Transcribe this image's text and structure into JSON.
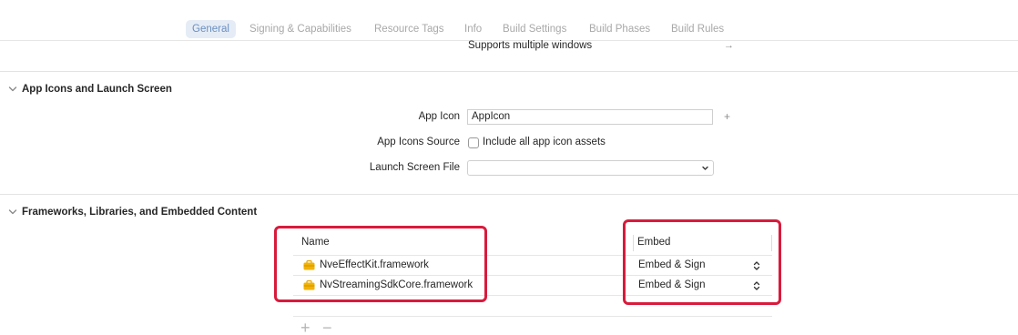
{
  "tabs": [
    {
      "label": "General",
      "active": true
    },
    {
      "label": "Signing & Capabilities",
      "active": false
    },
    {
      "label": "Resource Tags",
      "active": false
    },
    {
      "label": "Info",
      "active": false
    },
    {
      "label": "Build Settings",
      "active": false
    },
    {
      "label": "Build Phases",
      "active": false
    },
    {
      "label": "Build Rules",
      "active": false
    }
  ],
  "deployment": {
    "supports_multiple_windows": "Supports multiple windows",
    "arrow_icon": "arrow-right-icon"
  },
  "app_icons_section": {
    "title": "App Icons and Launch Screen",
    "app_icon_label": "App Icon",
    "app_icon_value": "AppIcon",
    "app_icons_source_label": "App Icons Source",
    "include_all_label": "Include all app icon assets",
    "include_all_checked": false,
    "launch_screen_label": "Launch Screen File",
    "launch_screen_value": ""
  },
  "frameworks_section": {
    "title": "Frameworks, Libraries, and Embedded Content",
    "col_name": "Name",
    "col_embed": "Embed",
    "items": [
      {
        "name": "NveEffectKit.framework",
        "embed": "Embed & Sign",
        "icon": "framework-toolbox-icon"
      },
      {
        "name": "NvStreamingSdkCore.framework",
        "embed": "Embed & Sign",
        "icon": "framework-toolbox-icon"
      }
    ],
    "add_symbol": "+",
    "remove_symbol": "−"
  },
  "colors": {
    "highlight_box": "#d81b3c",
    "active_tab_bg": "#e5ecf6",
    "active_tab_text": "#6a8fc0",
    "framework_icon": "#f2b300"
  }
}
